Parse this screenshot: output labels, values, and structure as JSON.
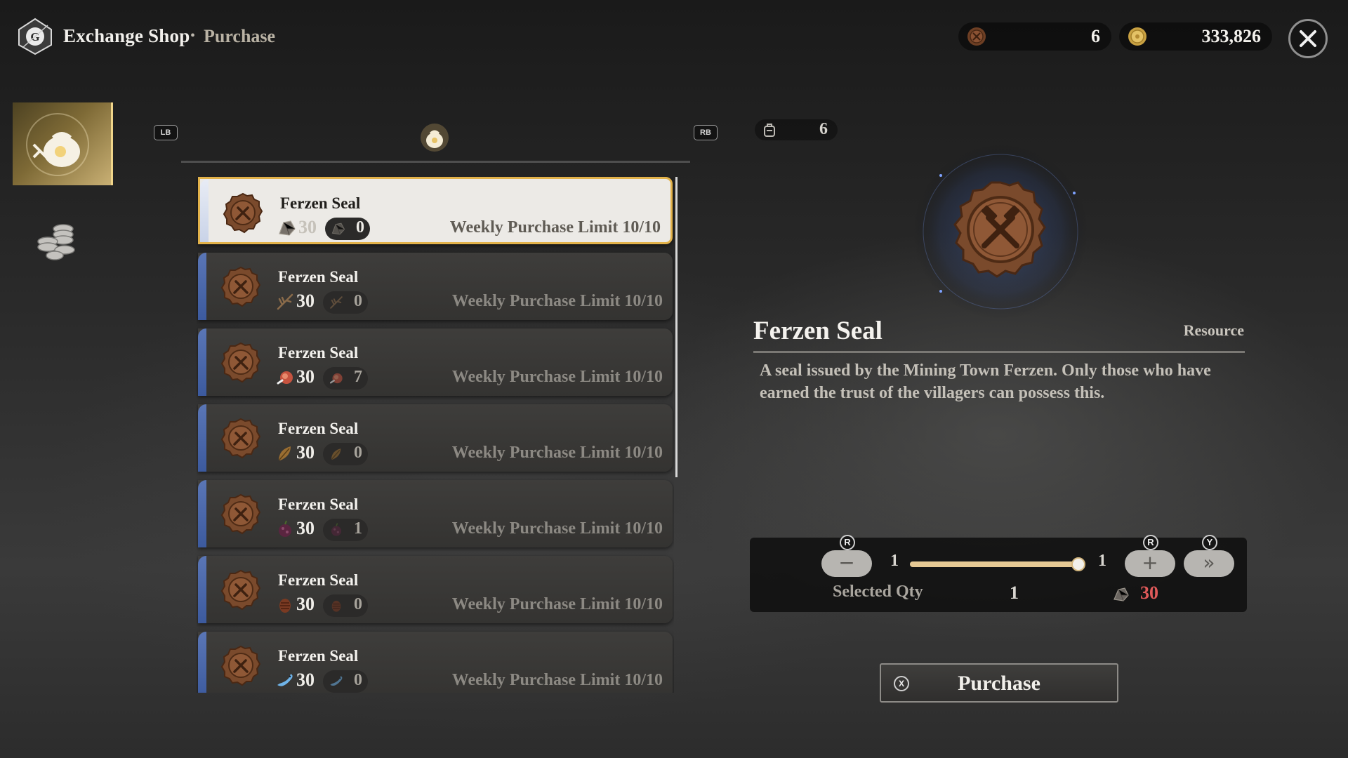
{
  "header": {
    "title": "Exchange Shop",
    "separator": "•",
    "subtitle": "Purchase"
  },
  "currencies": [
    {
      "icon": "ferzen-seal-icon",
      "value": "6"
    },
    {
      "icon": "gold-coin-icon",
      "value": "333,826"
    }
  ],
  "tabs": {
    "prev_button": "LB",
    "next_button": "RB",
    "active_icon": "pouch-icon"
  },
  "items": [
    {
      "name": "Ferzen Seal",
      "cost": "30",
      "cost_icon": "ore-icon",
      "owned": "0",
      "limit": "Weekly Purchase Limit 10/10"
    },
    {
      "name": "Ferzen Seal",
      "cost": "30",
      "cost_icon": "branch-icon",
      "owned": "0",
      "limit": "Weekly Purchase Limit 10/10"
    },
    {
      "name": "Ferzen Seal",
      "cost": "30",
      "cost_icon": "meat-icon",
      "owned": "7",
      "limit": "Weekly Purchase Limit 10/10"
    },
    {
      "name": "Ferzen Seal",
      "cost": "30",
      "cost_icon": "leaf-icon",
      "owned": "0",
      "limit": "Weekly Purchase Limit 10/10"
    },
    {
      "name": "Ferzen Seal",
      "cost": "30",
      "cost_icon": "berry-icon",
      "owned": "1",
      "limit": "Weekly Purchase Limit 10/10"
    },
    {
      "name": "Ferzen Seal",
      "cost": "30",
      "cost_icon": "pinecone-icon",
      "owned": "0",
      "limit": "Weekly Purchase Limit 10/10"
    },
    {
      "name": "Ferzen Seal",
      "cost": "30",
      "cost_icon": "fish-icon",
      "owned": "0",
      "limit": "Weekly Purchase Limit 10/10"
    }
  ],
  "detail": {
    "held": "6",
    "name": "Ferzen Seal",
    "type": "Resource",
    "description": "A seal issued by the Mining Town Ferzen. Only those who have earned the trust of the villagers can possess this."
  },
  "quantity": {
    "minus_label": "−",
    "plus_label": "+",
    "max_label": "»",
    "stick_button": "R",
    "max_button": "Y",
    "min": "1",
    "max": "1",
    "slider_fraction": 1.0,
    "selected_label": "Selected Qty",
    "selected_value": "1",
    "total_cost": "30"
  },
  "purchase": {
    "button_glyph": "X",
    "label": "Purchase"
  },
  "colors": {
    "accent_gold": "#e2b24a",
    "cost_red": "#e05a5a",
    "item_accent_blue": "#4a68aa",
    "seal_brown": "#7a4a2c"
  }
}
